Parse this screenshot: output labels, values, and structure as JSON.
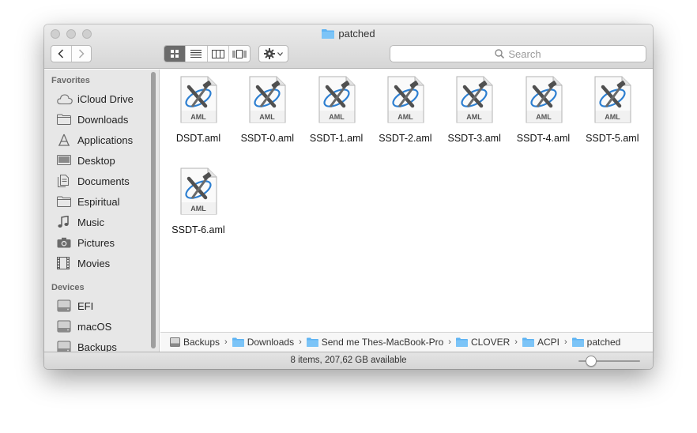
{
  "window": {
    "title": "patched"
  },
  "toolbar": {
    "back_icon": "chevron-left-icon",
    "forward_icon": "chevron-right-icon",
    "views": [
      "icon-view",
      "list-view",
      "column-view",
      "cover-flow-view"
    ],
    "active_view": "icon-view",
    "action_icon": "gear-icon",
    "search_placeholder": "Search"
  },
  "sidebar": {
    "favorites_heading": "Favorites",
    "favorites": [
      {
        "label": "iCloud Drive",
        "icon": "cloud-icon"
      },
      {
        "label": "Downloads",
        "icon": "folder-icon"
      },
      {
        "label": "Applications",
        "icon": "applications-icon"
      },
      {
        "label": "Desktop",
        "icon": "desktop-icon"
      },
      {
        "label": "Documents",
        "icon": "documents-icon"
      },
      {
        "label": "Espiritual",
        "icon": "folder-icon"
      },
      {
        "label": "Music",
        "icon": "music-icon"
      },
      {
        "label": "Pictures",
        "icon": "camera-icon"
      },
      {
        "label": "Movies",
        "icon": "film-icon"
      }
    ],
    "devices_heading": "Devices",
    "devices": [
      {
        "label": "EFI",
        "icon": "disk-icon"
      },
      {
        "label": "macOS",
        "icon": "disk-icon"
      },
      {
        "label": "Backups",
        "icon": "disk-icon"
      }
    ]
  },
  "files": [
    {
      "name": "DSDT.aml",
      "badge": "AML"
    },
    {
      "name": "SSDT-0.aml",
      "badge": "AML"
    },
    {
      "name": "SSDT-1.aml",
      "badge": "AML"
    },
    {
      "name": "SSDT-2.aml",
      "badge": "AML"
    },
    {
      "name": "SSDT-3.aml",
      "badge": "AML"
    },
    {
      "name": "SSDT-4.aml",
      "badge": "AML"
    },
    {
      "name": "SSDT-5.aml",
      "badge": "AML"
    },
    {
      "name": "SSDT-6.aml",
      "badge": "AML"
    }
  ],
  "pathbar": [
    {
      "label": "Backups",
      "icon": "disk-icon"
    },
    {
      "label": "Downloads",
      "icon": "folder-icon"
    },
    {
      "label": "Send me Thes-MacBook-Pro",
      "icon": "folder-icon"
    },
    {
      "label": "CLOVER",
      "icon": "folder-icon"
    },
    {
      "label": "ACPI",
      "icon": "folder-icon"
    },
    {
      "label": "patched",
      "icon": "folder-icon"
    }
  ],
  "status": {
    "text": "8 items, 207,62 GB available",
    "icon_size_level": 0.2
  },
  "colors": {
    "folder_blue": "#5fb4f3",
    "active_view_bg": "#6b6b6b",
    "sidebar_bg": "#e7e7e7"
  }
}
